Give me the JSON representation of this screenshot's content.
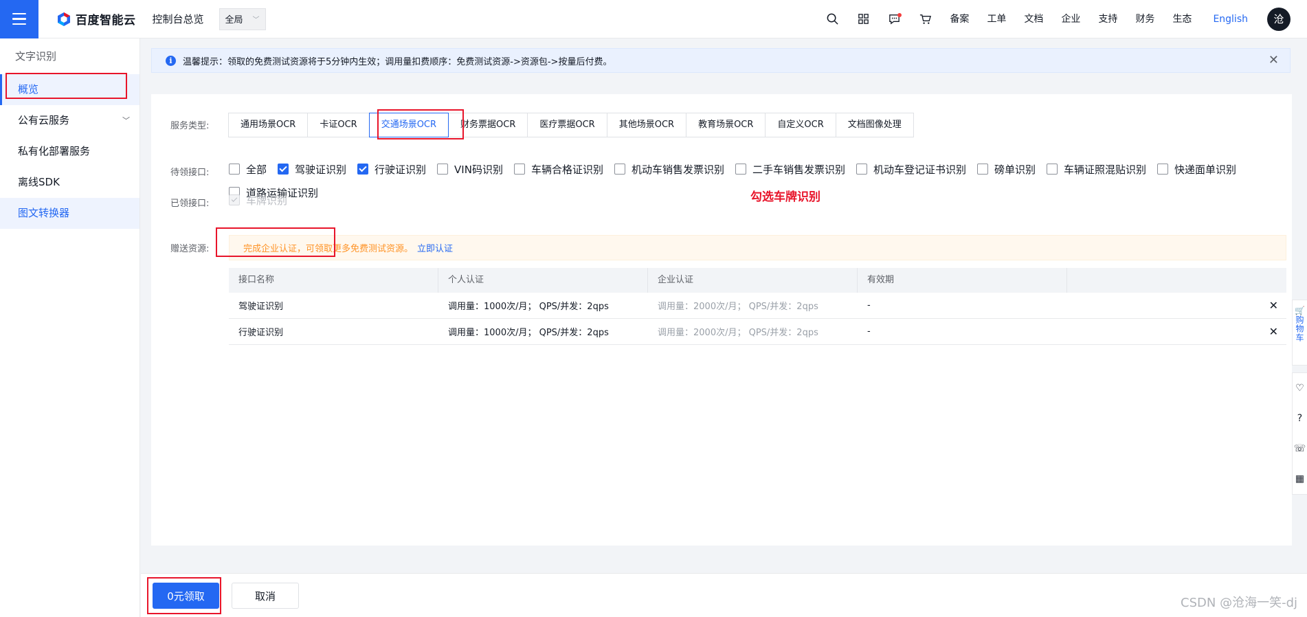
{
  "header": {
    "logo_text": "百度智能云",
    "console_link": "控制台总览",
    "region": "全局",
    "icons": [
      "search-icon",
      "apps-grid-icon",
      "message-icon",
      "cart-icon"
    ],
    "nav": [
      "备案",
      "工单",
      "文档",
      "企业",
      "支持",
      "财务",
      "生态"
    ],
    "language": "English",
    "avatar": "沧"
  },
  "sidebar": {
    "title": "文字识别",
    "items": [
      {
        "label": "概览"
      },
      {
        "label": "公有云服务"
      },
      {
        "label": "私有化部署服务"
      },
      {
        "label": "离线SDK"
      },
      {
        "label": "图文转换器"
      }
    ]
  },
  "notice": {
    "text": "温馨提示：领取的免费测试资源将于5分钟内生效；调用量扣费顺序：免费测试资源->资源包->按量后付费。"
  },
  "form": {
    "service_type_label": "服务类型:",
    "tabs": [
      "通用场景OCR",
      "卡证OCR",
      "交通场景OCR",
      "财务票据OCR",
      "医疗票据OCR",
      "其他场景OCR",
      "教育场景OCR",
      "自定义OCR",
      "文档图像处理"
    ],
    "active_tab": "交通场景OCR",
    "pending_label": "待领接口:",
    "pending_interfaces": [
      {
        "label": "全部",
        "checked": false
      },
      {
        "label": "驾驶证识别",
        "checked": true
      },
      {
        "label": "行驶证识别",
        "checked": true
      },
      {
        "label": "VIN码识别",
        "checked": false
      },
      {
        "label": "车辆合格证识别",
        "checked": false
      },
      {
        "label": "机动车销售发票识别",
        "checked": false
      },
      {
        "label": "二手车销售发票识别",
        "checked": false
      },
      {
        "label": "机动车登记证书识别",
        "checked": false
      },
      {
        "label": "磅单识别",
        "checked": false
      },
      {
        "label": "车辆证照混贴识别",
        "checked": false
      },
      {
        "label": "快递面单识别",
        "checked": false
      },
      {
        "label": "道路运输证识别",
        "checked": false
      }
    ],
    "annotation": "勾选车牌识别",
    "received_label": "已领接口:",
    "received_interfaces": [
      {
        "label": "车牌识别",
        "checked": true,
        "disabled": true
      }
    ],
    "bonus_label": "赠送资源:",
    "bonus_notice": "完成企业认证，可领取更多免费测试资源。",
    "bonus_link": "立即认证"
  },
  "table": {
    "headers": [
      "接口名称",
      "个人认证",
      "企业认证",
      "有效期"
    ],
    "rows": [
      {
        "name": "驾驶证识别",
        "personal": "调用量：1000次/月； QPS/并发：2qps",
        "enterprise": "调用量：2000次/月； QPS/并发：2qps",
        "validity": "-"
      },
      {
        "name": "行驶证识别",
        "personal": "调用量：1000次/月； QPS/并发：2qps",
        "enterprise": "调用量：2000次/月； QPS/并发：2qps",
        "validity": "-"
      }
    ]
  },
  "footer": {
    "claim_button": "0元领取",
    "cancel_button": "取消",
    "watermark": "CSDN @沧海一笑-dj"
  },
  "float_tools": {
    "cart_label": "购物车"
  },
  "colors": {
    "primary": "#2468f2",
    "annotation_red": "#e8142a",
    "warning_orange": "#ff9326"
  }
}
